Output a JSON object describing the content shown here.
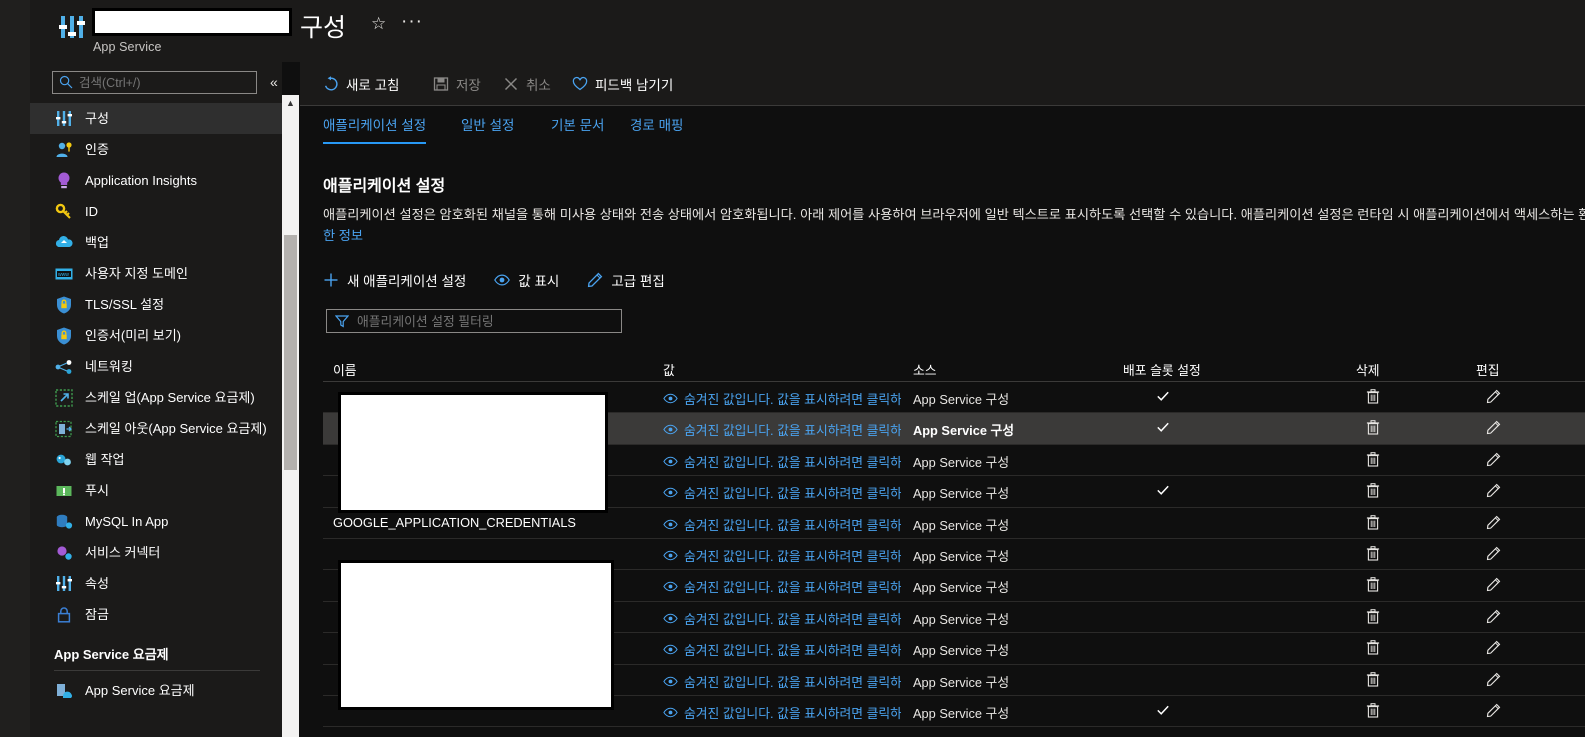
{
  "header": {
    "title": "구성",
    "subtitle": "App Service",
    "resource_name_redacted": "",
    "star_glyph": "☆",
    "more_glyph": "···"
  },
  "sidebar": {
    "search_placeholder": "검색(Ctrl+/)",
    "collapse_glyph": "«",
    "items": [
      {
        "label": "구성",
        "icon": "sliders-icon",
        "active": true
      },
      {
        "label": "인증",
        "icon": "person-key-icon",
        "active": false
      },
      {
        "label": "Application Insights",
        "icon": "lightbulb-icon",
        "active": false
      },
      {
        "label": "ID",
        "icon": "key-icon",
        "active": false
      },
      {
        "label": "백업",
        "icon": "cloud-backup-icon",
        "active": false
      },
      {
        "label": "사용자 지정 도메인",
        "icon": "domain-icon",
        "active": false
      },
      {
        "label": "TLS/SSL 설정",
        "icon": "shield-lock-icon",
        "active": false
      },
      {
        "label": "인증서(미리 보기)",
        "icon": "shield-lock-icon",
        "active": false
      },
      {
        "label": "네트워킹",
        "icon": "networking-icon",
        "active": false
      },
      {
        "label": "스케일 업(App Service 요금제)",
        "icon": "scale-up-icon",
        "active": false
      },
      {
        "label": "스케일 아웃(App Service 요금제)",
        "icon": "scale-out-icon",
        "active": false
      },
      {
        "label": "웹 작업",
        "icon": "webjobs-icon",
        "active": false
      },
      {
        "label": "푸시",
        "icon": "push-icon",
        "active": false
      },
      {
        "label": "MySQL In App",
        "icon": "mysql-icon",
        "active": false
      },
      {
        "label": "서비스 커넥터",
        "icon": "service-connector-icon",
        "active": false
      },
      {
        "label": "속성",
        "icon": "sliders-icon",
        "active": false
      },
      {
        "label": "잠금",
        "icon": "lock-icon",
        "active": false
      }
    ],
    "section_label": "App Service 요금제",
    "section_items": [
      {
        "label": "App Service 요금제",
        "icon": "app-service-plan-icon"
      }
    ]
  },
  "commandbar": {
    "refresh": "새로 고침",
    "save": "저장",
    "cancel": "취소",
    "feedback": "피드백 남기기"
  },
  "tabs": [
    {
      "label": "애플리케이션 설정",
      "active": true
    },
    {
      "label": "일반 설정",
      "active": false
    },
    {
      "label": "기본 문서",
      "active": false
    },
    {
      "label": "경로 매핑",
      "active": false
    }
  ],
  "section": {
    "title": "애플리케이션 설정",
    "description": "애플리케이션 설정은 암호화된 채널을 통해 미사용 상태와 전송 상태에서 암호화됩니다. 아래 제어를 사용하여 브라우저에 일반 텍스트로 표시하도록 선택할 수 있습니다. 애플리케이션 설정은 런타임 시 애플리케이션에서 액세스하는 환경 변수로 노출됩니다. ",
    "learn_more": "자세한 정보"
  },
  "actions": {
    "new_setting": "새 애플리케이션 설정",
    "show_values": "값 표시",
    "advanced_edit": "고급 편집"
  },
  "filter": {
    "placeholder": "애플리케이션 설정 필터링"
  },
  "table": {
    "headers": [
      "이름",
      "값",
      "소스",
      "배포 슬롯 설정",
      "삭제",
      "편집"
    ],
    "hidden_value_text": "숨겨진 값입니다. 값을 표시하려면 클릭하",
    "source_value": "App Service 구성",
    "checkmark": "✓",
    "rows": [
      {
        "name": "",
        "redacted": true,
        "slot": true,
        "hover": false
      },
      {
        "name": "",
        "redacted": true,
        "slot": true,
        "hover": true
      },
      {
        "name": "",
        "redacted": true,
        "slot": false,
        "hover": false
      },
      {
        "name": "",
        "redacted": true,
        "slot": true,
        "hover": false
      },
      {
        "name": "GOOGLE_APPLICATION_CREDENTIALS",
        "redacted": false,
        "slot": false,
        "hover": false
      },
      {
        "name": "",
        "redacted": true,
        "slot": false,
        "hover": false
      },
      {
        "name": "",
        "redacted": true,
        "slot": false,
        "hover": false
      },
      {
        "name": "",
        "redacted": true,
        "slot": false,
        "hover": false
      },
      {
        "name": "",
        "redacted": true,
        "slot": false,
        "hover": false
      },
      {
        "name": "",
        "redacted": true,
        "slot": false,
        "hover": false
      },
      {
        "name": "",
        "redacted": true,
        "slot": true,
        "hover": false
      }
    ]
  },
  "colors": {
    "accent": "#2899f5",
    "link": "#4aa3f0",
    "background": "#0f0f0f",
    "panel": "#1b1a19",
    "hover_row": "#3b3a39"
  }
}
